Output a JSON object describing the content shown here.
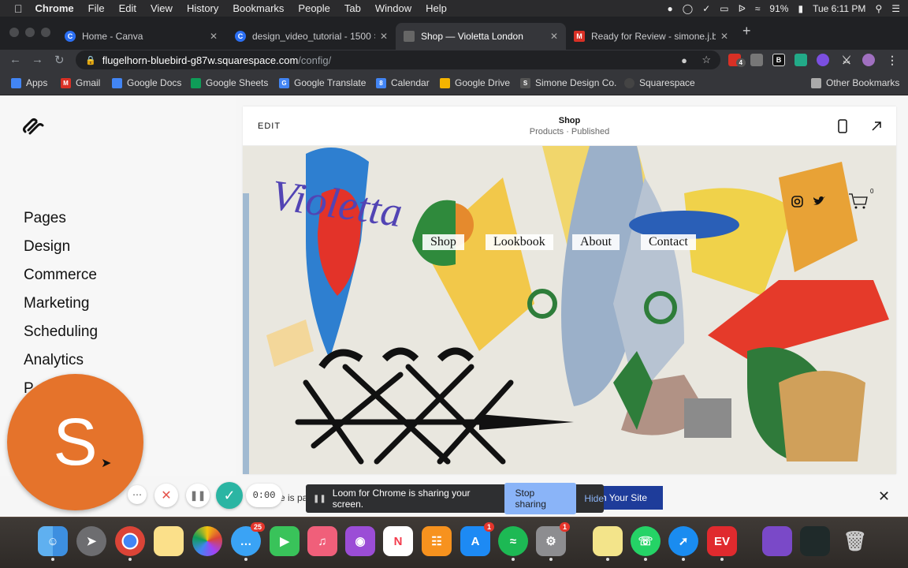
{
  "menubar": {
    "apple": "",
    "app": "Chrome",
    "items": [
      "File",
      "Edit",
      "View",
      "History",
      "Bookmarks",
      "People",
      "Tab",
      "Window",
      "Help"
    ],
    "battery": "91%",
    "clock": "Tue 6:11 PM"
  },
  "tabs": [
    {
      "title": "Home - Canva",
      "fav": "C",
      "color": "#2b6ff3"
    },
    {
      "title": "design_video_tutorial - 1500 ×",
      "fav": "C",
      "color": "#2b6ff3"
    },
    {
      "title": "Shop — Violetta London",
      "fav": "■",
      "color": "#666"
    },
    {
      "title": "Ready for Review - simone.j.ba",
      "fav": "M",
      "color": "#d93025"
    }
  ],
  "omnibox": {
    "host": "flugelhorn-bluebird-g87w.squarespace.com",
    "path": "/config/"
  },
  "extensions": {
    "badge": "4"
  },
  "bookmarks": [
    {
      "label": "Apps",
      "color": "#4285f4"
    },
    {
      "label": "Gmail",
      "color": "#d93025"
    },
    {
      "label": "Google Docs",
      "color": "#4285f4"
    },
    {
      "label": "Google Sheets",
      "color": "#0f9d58"
    },
    {
      "label": "Google Translate",
      "color": "#4285f4"
    },
    {
      "label": "Calendar",
      "color": "#4285f4"
    },
    {
      "label": "Google Drive",
      "color": "#f4b400"
    },
    {
      "label": "Simone Design Co.",
      "color": "#555"
    },
    {
      "label": "Squarespace",
      "color": "#444"
    },
    {
      "label": "Other Bookmarks",
      "color": "#aaa"
    }
  ],
  "sidebar": {
    "items": [
      "Pages",
      "Design",
      "Commerce",
      "Marketing",
      "Scheduling",
      "Analytics",
      "P"
    ]
  },
  "preview": {
    "edit": "EDIT",
    "title": "Shop",
    "subtitle": "Products · Published",
    "site_nav": [
      "Shop",
      "Lookbook",
      "About",
      "Contact"
    ],
    "logo": "Violetta",
    "cart_count": "0"
  },
  "publish": {
    "left_text": "e is pa",
    "button": "h Your Site"
  },
  "loom": {
    "avatar_letter": "S",
    "timer": "0:00",
    "sharing_text": "Loom for Chrome is sharing your screen.",
    "stop": "Stop sharing",
    "hide": "Hide"
  },
  "dock": {
    "messages_badge": "25",
    "calendar_badge": "1",
    "appstore_badge": "1",
    "prefs_badge": "1"
  }
}
